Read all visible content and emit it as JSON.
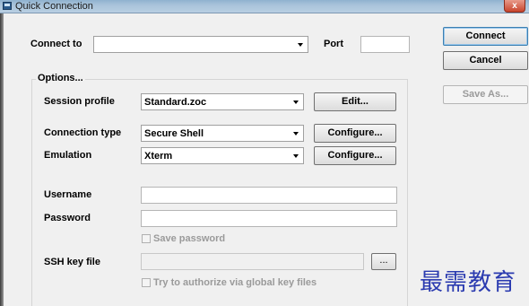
{
  "window": {
    "title": "Quick Connection"
  },
  "connect": {
    "label": "Connect to",
    "value": "",
    "port_label": "Port",
    "port_value": ""
  },
  "buttons": {
    "connect": "Connect",
    "cancel": "Cancel",
    "save_as": "Save As...",
    "edit": "Edit...",
    "configure_connection": "Configure...",
    "configure_emulation": "Configure...",
    "browse": "..."
  },
  "options": {
    "group_label": "Options...",
    "session_profile_label": "Session profile",
    "session_profile_value": "Standard.zoc",
    "connection_type_label": "Connection type",
    "connection_type_value": "Secure Shell",
    "emulation_label": "Emulation",
    "emulation_value": "Xterm",
    "username_label": "Username",
    "username_value": "",
    "password_label": "Password",
    "password_value": "",
    "save_password_label": "Save password",
    "ssh_key_label": "SSH key file",
    "ssh_key_value": "",
    "global_key_label": "Try to authorize via global key files"
  },
  "watermark": "最需教育",
  "colors": {
    "titlebar": "#a9c3da",
    "close_button": "#c8442c",
    "watermark": "#2b3bb0",
    "background": "#f0f0f0"
  }
}
